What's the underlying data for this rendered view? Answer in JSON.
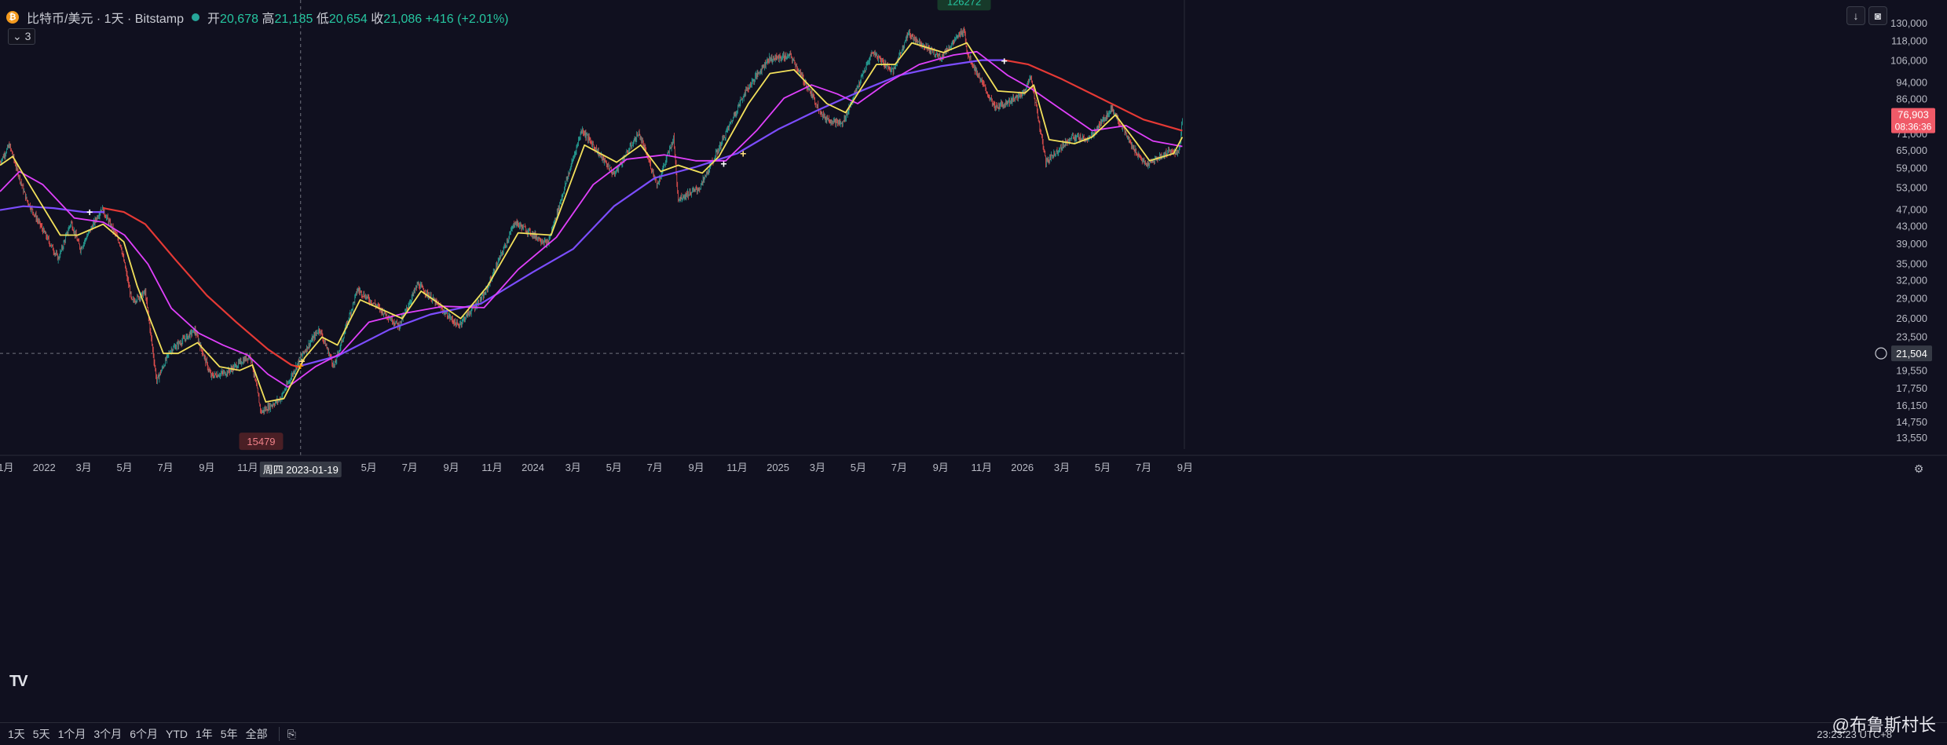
{
  "header": {
    "coin_glyph": "₿",
    "symbol": "比特币/美元 · 1天 · Bitstamp",
    "open_label": "开",
    "open": "20,678",
    "high_label": "高",
    "high": "21,185",
    "low_label": "低",
    "low": "20,654",
    "close_label": "收",
    "close": "21,086",
    "change": "+416 (+2.01%)",
    "indicator_count": "3"
  },
  "icons": {
    "collapse": "chevron-down-icon",
    "download": "download-icon",
    "camera": "camera-icon",
    "logo": "tradingview-logo-icon",
    "target": "target-icon",
    "settings": "settings-icon"
  },
  "colors": {
    "background": "#10101f",
    "up": "#26a69a",
    "down": "#ef5350",
    "ma_short": "#f2e05b",
    "ma_mid": "#e040fb",
    "ma_200": "#7c4dff",
    "ma_long": "#e53935",
    "price_tag": "#f05a68"
  },
  "chart_data": {
    "type": "line",
    "scale": "log",
    "y_range": [
      13550,
      130000
    ],
    "y_ticks": [
      130000,
      118000,
      106000,
      94000,
      86000,
      78500,
      71000,
      65000,
      59000,
      53000,
      47000,
      43000,
      39000,
      35000,
      32000,
      29000,
      26000,
      23500,
      21500,
      19550,
      17750,
      16150,
      14750,
      13550
    ],
    "x_range": [
      "2021-10-27",
      "2026-08-31"
    ],
    "x_ticks": [
      {
        "date": "2021-11-01",
        "label": "11月"
      },
      {
        "date": "2022-01-01",
        "label": "2022"
      },
      {
        "date": "2022-03-01",
        "label": "3月"
      },
      {
        "date": "2022-05-01",
        "label": "5月"
      },
      {
        "date": "2022-07-01",
        "label": "7月"
      },
      {
        "date": "2022-09-01",
        "label": "9月"
      },
      {
        "date": "2022-11-01",
        "label": "11月"
      },
      {
        "date": "2023-03-01",
        "label": "3月"
      },
      {
        "date": "2023-05-01",
        "label": "5月"
      },
      {
        "date": "2023-07-01",
        "label": "7月"
      },
      {
        "date": "2023-09-01",
        "label": "9月"
      },
      {
        "date": "2023-11-01",
        "label": "11月"
      },
      {
        "date": "2024-01-01",
        "label": "2024"
      },
      {
        "date": "2024-03-01",
        "label": "3月"
      },
      {
        "date": "2024-05-01",
        "label": "5月"
      },
      {
        "date": "2024-07-01",
        "label": "7月"
      },
      {
        "date": "2024-09-01",
        "label": "9月"
      },
      {
        "date": "2024-11-01",
        "label": "11月"
      },
      {
        "date": "2025-01-01",
        "label": "2025"
      },
      {
        "date": "2025-03-01",
        "label": "3月"
      },
      {
        "date": "2025-05-01",
        "label": "5月"
      },
      {
        "date": "2025-07-01",
        "label": "7月"
      },
      {
        "date": "2025-09-01",
        "label": "9月"
      },
      {
        "date": "2025-11-01",
        "label": "11月"
      },
      {
        "date": "2026-01-01",
        "label": "2026"
      },
      {
        "date": "2026-03-01",
        "label": "3月"
      },
      {
        "date": "2026-05-01",
        "label": "5月"
      },
      {
        "date": "2026-07-01",
        "label": "7月"
      },
      {
        "date": "2026-09-01",
        "label": "9月"
      }
    ],
    "price_series": [
      [
        "2021-10-27",
        61000
      ],
      [
        "2021-11-10",
        67000
      ],
      [
        "2021-12-05",
        50000
      ],
      [
        "2022-01-22",
        36000
      ],
      [
        "2022-02-10",
        44000
      ],
      [
        "2022-02-24",
        38000
      ],
      [
        "2022-03-28",
        47500
      ],
      [
        "2022-04-25",
        39000
      ],
      [
        "2022-05-12",
        28500
      ],
      [
        "2022-06-01",
        30000
      ],
      [
        "2022-06-18",
        18500
      ],
      [
        "2022-07-08",
        21800
      ],
      [
        "2022-08-14",
        24400
      ],
      [
        "2022-09-07",
        19000
      ],
      [
        "2022-10-01",
        19400
      ],
      [
        "2022-11-05",
        21300
      ],
      [
        "2022-11-21",
        15600
      ],
      [
        "2022-12-20",
        16800
      ],
      [
        "2023-01-19",
        21086
      ],
      [
        "2023-02-16",
        24600
      ],
      [
        "2023-03-10",
        20000
      ],
      [
        "2023-04-14",
        30500
      ],
      [
        "2023-06-15",
        25000
      ],
      [
        "2023-07-13",
        31400
      ],
      [
        "2023-09-11",
        25000
      ],
      [
        "2023-10-20",
        29500
      ],
      [
        "2023-12-05",
        44000
      ],
      [
        "2024-01-23",
        39000
      ],
      [
        "2024-03-14",
        73000
      ],
      [
        "2024-05-01",
        57000
      ],
      [
        "2024-06-07",
        71500
      ],
      [
        "2024-07-05",
        54000
      ],
      [
        "2024-07-29",
        69500
      ],
      [
        "2024-08-05",
        50000
      ],
      [
        "2024-09-06",
        53000
      ],
      [
        "2024-10-01",
        64000
      ],
      [
        "2024-11-12",
        89000
      ],
      [
        "2024-12-17",
        107000
      ],
      [
        "2025-01-20",
        109000
      ],
      [
        "2025-03-10",
        78000
      ],
      [
        "2025-04-07",
        75000
      ],
      [
        "2025-05-22",
        111500
      ],
      [
        "2025-06-22",
        100000
      ],
      [
        "2025-07-14",
        123000
      ],
      [
        "2025-09-01",
        108000
      ],
      [
        "2025-10-06",
        126000
      ],
      [
        "2025-10-11",
        110000
      ],
      [
        "2025-11-21",
        82000
      ],
      [
        "2025-12-31",
        88000
      ],
      [
        "2026-01-14",
        97000
      ],
      [
        "2026-02-05",
        61000
      ],
      [
        "2026-03-15",
        70000
      ],
      [
        "2026-04-10",
        69000
      ],
      [
        "2026-05-15",
        82000
      ],
      [
        "2026-06-15",
        66000
      ],
      [
        "2026-07-05",
        60000
      ],
      [
        "2026-08-10",
        65000
      ],
      [
        "2026-08-22",
        64000
      ],
      [
        "2026-08-26",
        70500
      ],
      [
        "2026-08-28",
        76903
      ]
    ],
    "ma_short": [
      [
        "2021-10-27",
        60000
      ],
      [
        "2021-11-15",
        63000
      ],
      [
        "2021-12-10",
        54000
      ],
      [
        "2022-01-25",
        41000
      ],
      [
        "2022-02-20",
        41000
      ],
      [
        "2022-03-30",
        43500
      ],
      [
        "2022-04-30",
        39500
      ],
      [
        "2022-05-20",
        31000
      ],
      [
        "2022-06-28",
        21500
      ],
      [
        "2022-07-20",
        21500
      ],
      [
        "2022-08-18",
        22800
      ],
      [
        "2022-09-20",
        20000
      ],
      [
        "2022-10-20",
        19600
      ],
      [
        "2022-11-08",
        20200
      ],
      [
        "2022-11-28",
        16500
      ],
      [
        "2022-12-25",
        16800
      ],
      [
        "2023-01-25",
        21000
      ],
      [
        "2023-02-20",
        23500
      ],
      [
        "2023-03-15",
        22500
      ],
      [
        "2023-04-18",
        28800
      ],
      [
        "2023-06-20",
        26000
      ],
      [
        "2023-07-18",
        30200
      ],
      [
        "2023-09-15",
        26000
      ],
      [
        "2023-10-25",
        31000
      ],
      [
        "2023-12-10",
        41500
      ],
      [
        "2024-01-28",
        41000
      ],
      [
        "2024-03-18",
        67000
      ],
      [
        "2024-05-05",
        61000
      ],
      [
        "2024-06-10",
        67000
      ],
      [
        "2024-07-10",
        58000
      ],
      [
        "2024-08-05",
        60000
      ],
      [
        "2024-09-10",
        57500
      ],
      [
        "2024-10-05",
        63000
      ],
      [
        "2024-11-18",
        84000
      ],
      [
        "2024-12-20",
        99000
      ],
      [
        "2025-01-25",
        101000
      ],
      [
        "2025-03-15",
        84000
      ],
      [
        "2025-04-12",
        80000
      ],
      [
        "2025-05-28",
        104000
      ],
      [
        "2025-06-25",
        104000
      ],
      [
        "2025-07-20",
        117000
      ],
      [
        "2025-09-05",
        111000
      ],
      [
        "2025-10-10",
        117000
      ],
      [
        "2025-11-25",
        90000
      ],
      [
        "2026-01-05",
        89000
      ],
      [
        "2026-01-18",
        93000
      ],
      [
        "2026-02-10",
        69000
      ],
      [
        "2026-03-20",
        67500
      ],
      [
        "2026-04-15",
        70000
      ],
      [
        "2026-05-20",
        79000
      ],
      [
        "2026-06-20",
        68000
      ],
      [
        "2026-07-10",
        61500
      ],
      [
        "2026-08-15",
        64000
      ],
      [
        "2026-08-28",
        70000
      ]
    ],
    "ma_mid": [
      [
        "2021-10-27",
        52000
      ],
      [
        "2021-11-25",
        58000
      ],
      [
        "2021-12-30",
        54000
      ],
      [
        "2022-02-15",
        45000
      ],
      [
        "2022-03-30",
        44000
      ],
      [
        "2022-05-01",
        41000
      ],
      [
        "2022-06-05",
        35000
      ],
      [
        "2022-07-10",
        27500
      ],
      [
        "2022-08-20",
        24000
      ],
      [
        "2022-09-25",
        22500
      ],
      [
        "2022-11-01",
        21300
      ],
      [
        "2022-12-01",
        19200
      ],
      [
        "2022-12-31",
        17900
      ],
      [
        "2023-02-10",
        20000
      ],
      [
        "2023-03-20",
        21500
      ],
      [
        "2023-05-01",
        25500
      ],
      [
        "2023-06-25",
        26800
      ],
      [
        "2023-08-20",
        27800
      ],
      [
        "2023-10-20",
        27600
      ],
      [
        "2023-12-10",
        34000
      ],
      [
        "2024-02-05",
        40500
      ],
      [
        "2024-03-31",
        54000
      ],
      [
        "2024-05-20",
        62000
      ],
      [
        "2024-07-15",
        63500
      ],
      [
        "2024-08-31",
        61500
      ],
      [
        "2024-10-15",
        61500
      ],
      [
        "2024-11-30",
        72500
      ],
      [
        "2025-01-10",
        86500
      ],
      [
        "2025-02-20",
        93000
      ],
      [
        "2025-03-31",
        88500
      ],
      [
        "2025-04-30",
        84000
      ],
      [
        "2025-06-10",
        93500
      ],
      [
        "2025-07-31",
        104000
      ],
      [
        "2025-09-20",
        109500
      ],
      [
        "2025-10-25",
        111500
      ],
      [
        "2025-12-10",
        98000
      ],
      [
        "2026-01-15",
        91000
      ],
      [
        "2026-02-25",
        82000
      ],
      [
        "2026-04-15",
        72500
      ],
      [
        "2026-06-05",
        74500
      ],
      [
        "2026-07-15",
        68500
      ],
      [
        "2026-08-28",
        66500
      ]
    ],
    "ma_200": [
      [
        "2021-10-27",
        47000
      ],
      [
        "2021-12-01",
        48000
      ],
      [
        "2022-01-15",
        47500
      ],
      [
        "2022-03-01",
        46500
      ],
      [
        "2022-04-01",
        46500
      ],
      [
        "2023-01-19",
        20100
      ],
      [
        "2023-03-15",
        21200
      ],
      [
        "2023-06-01",
        24500
      ],
      [
        "2023-08-01",
        26600
      ],
      [
        "2023-10-15",
        28200
      ],
      [
        "2024-01-01",
        33500
      ],
      [
        "2024-03-01",
        38000
      ],
      [
        "2024-05-01",
        48000
      ],
      [
        "2024-07-01",
        56000
      ],
      [
        "2024-09-01",
        59500
      ],
      [
        "2024-11-01",
        64000
      ],
      [
        "2025-01-01",
        73000
      ],
      [
        "2025-03-01",
        81000
      ],
      [
        "2025-05-01",
        89500
      ],
      [
        "2025-07-01",
        98000
      ],
      [
        "2025-09-01",
        103000
      ],
      [
        "2025-11-01",
        106500
      ],
      [
        "2025-12-05",
        106500
      ]
    ],
    "ma_long": [
      [
        "2022-03-30",
        47500
      ],
      [
        "2022-04-30",
        46500
      ],
      [
        "2022-06-01",
        43500
      ],
      [
        "2022-07-15",
        36000
      ],
      [
        "2022-09-01",
        29500
      ],
      [
        "2022-10-15",
        25500
      ],
      [
        "2022-12-01",
        22000
      ],
      [
        "2023-01-05",
        20200
      ],
      [
        "2023-01-19",
        19900
      ],
      [
        "2025-12-05",
        106500
      ],
      [
        "2026-01-10",
        104000
      ],
      [
        "2026-03-01",
        96000
      ],
      [
        "2026-05-01",
        86000
      ],
      [
        "2026-07-01",
        77000
      ],
      [
        "2026-08-28",
        72500
      ]
    ],
    "crossover_markers": [
      {
        "date": "2022-03-10",
        "price": 46500,
        "color": "#ffffff"
      },
      {
        "date": "2023-01-19",
        "price": 20100,
        "color": "#ff9800"
      },
      {
        "date": "2023-01-21",
        "price": 20600,
        "color": "#ffe082"
      },
      {
        "date": "2024-10-12",
        "price": 60500,
        "color": "#ffffff"
      },
      {
        "date": "2024-11-10",
        "price": 64000,
        "color": "#ffe082"
      },
      {
        "date": "2025-12-05",
        "price": 106000,
        "color": "#ffffff"
      }
    ],
    "high_label": {
      "date": "2025-10-06",
      "price": 126000,
      "text": "126272"
    },
    "low_label": {
      "date": "2022-11-21",
      "price": 15600,
      "text": "15479"
    },
    "crosshair": {
      "date": "2023-01-19",
      "price": 21504,
      "x_label": "周四 2023-01-19",
      "y_label": "21,504"
    },
    "last_price": {
      "price": 76903,
      "label": "76,903",
      "countdown": "08:36:36"
    }
  },
  "toolbar": {
    "ranges": [
      "1天",
      "5天",
      "1个月",
      "3个月",
      "6个月",
      "YTD",
      "1年",
      "5年",
      "全部"
    ],
    "utc_time": "23:23:23 UTC+8"
  },
  "watermark": "@布鲁斯村长"
}
